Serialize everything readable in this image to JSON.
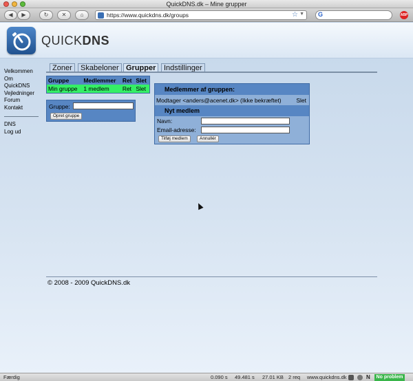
{
  "browser": {
    "window_title": "QuickDNS.dk – Mine grupper",
    "url": "https://www.quickdns.dk/groups",
    "search_engine_glyph": "G",
    "abp_label": "ABP",
    "colors": {
      "traffic_red": "#ee5b51",
      "traffic_yellow": "#f2b63f",
      "traffic_green": "#5cbc3c"
    }
  },
  "header": {
    "logo_word_light": "QUICK",
    "logo_word_bold": "DNS",
    "logo_icon": "stopwatch-logo-icon"
  },
  "nav": {
    "main": [
      "Velkommen",
      "Om QuickDNS",
      "Vejledninger",
      "Forum",
      "Kontakt"
    ],
    "secondary": [
      "DNS",
      "Log ud"
    ]
  },
  "tabs": [
    {
      "label": "Zoner",
      "active": false
    },
    {
      "label": "Skabeloner",
      "active": false
    },
    {
      "label": "Grupper",
      "active": true
    },
    {
      "label": "Indstillinger",
      "active": false
    }
  ],
  "groups_table": {
    "headers": [
      "Gruppe",
      "Medlemmer",
      "Ret",
      "Slet"
    ],
    "rows": [
      {
        "name": "Min gruppe",
        "members": "1 medlem",
        "edit": "Ret",
        "delete": "Slet"
      }
    ]
  },
  "create_group": {
    "label": "Gruppe:",
    "value": "",
    "button": "Opret gruppe"
  },
  "members_panel": {
    "title": "Medlemmer af gruppen:",
    "member_text": "Modtager <anders@acenet.dk> (Ikke bekræftet)",
    "member_delete": "Slet",
    "new_member_title": "Nyt medlem",
    "name_label": "Navn:",
    "name_value": "",
    "email_label": "Email-adresse:",
    "email_value": "",
    "add_button": "Tilføj medlem",
    "cancel_button": "Annullér"
  },
  "footer": {
    "copyright": "© 2008 - 2009 QuickDNS.dk"
  },
  "statusbar": {
    "status": "Færdig",
    "time1": "0.090 s",
    "time2": "49.481 s",
    "size": "27.01 KB",
    "requests": "2 req",
    "host": "www.quickdns.dk",
    "no_problem": "No problem"
  },
  "theme": {
    "table_head": "#5786c3",
    "row_highlight": "#35ef66",
    "panel_bg": "#8fb0d8",
    "status_ok": "#39b54a"
  }
}
